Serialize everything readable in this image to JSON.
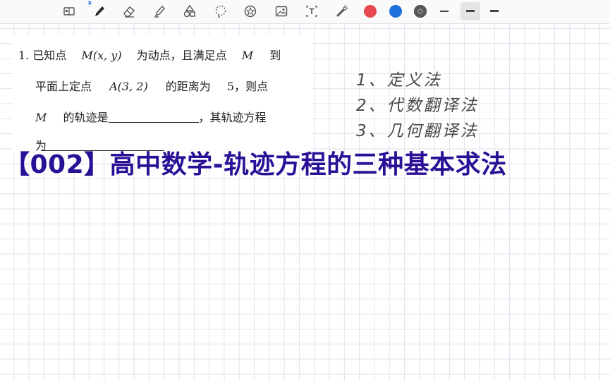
{
  "toolbar": {
    "tools": [
      {
        "name": "book-icon"
      },
      {
        "name": "pen-icon"
      },
      {
        "name": "eraser-icon"
      },
      {
        "name": "highlighter-icon"
      },
      {
        "name": "shapes-icon"
      },
      {
        "name": "lasso-icon"
      },
      {
        "name": "sticker-icon"
      },
      {
        "name": "image-icon"
      },
      {
        "name": "textbox-icon"
      },
      {
        "name": "laser-pointer-icon"
      }
    ],
    "colors": [
      "#e8484f",
      "#1e6fd9",
      "#555555"
    ],
    "selected_stroke": "medium"
  },
  "problem": {
    "line1_a": "1. 已知点",
    "line1_b": "M(x, y)",
    "line1_c": "为动点，且满足点",
    "line1_d": "M",
    "line1_e": "到",
    "line2_a": "平面上定点",
    "line2_b": "A(3, 2)",
    "line2_c": "的距离为",
    "line2_d": "5，则点",
    "line3_a": "M",
    "line3_b": "的轨迹是",
    "line3_c": "，其轨迹方程",
    "line4_a": "为"
  },
  "methods": [
    "1、定义法",
    "2、代数翻译法",
    "3、几何翻译法"
  ],
  "title": "【002】高中数学-轨迹方程的三种基本求法"
}
